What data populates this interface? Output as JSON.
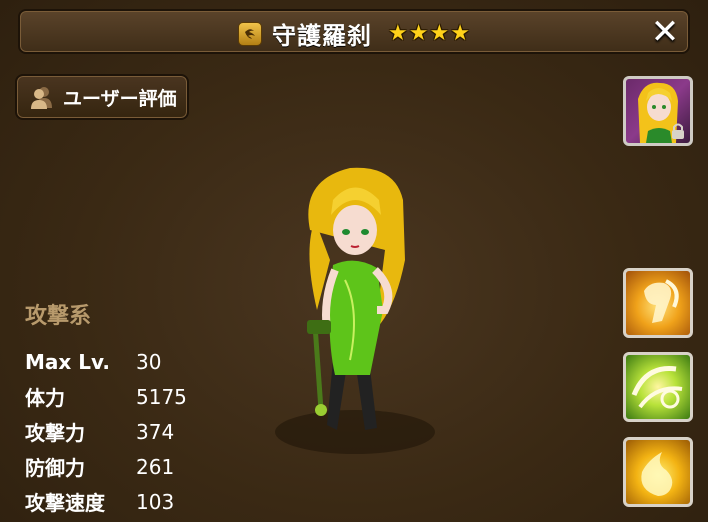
{
  "header": {
    "element_icon": "wind-element-icon",
    "title": "守護羅刹",
    "stars": [
      "★",
      "★",
      "★",
      "★"
    ],
    "close_icon": "✕"
  },
  "rating_button": {
    "icon": "users-icon",
    "label": "ユーザー評価"
  },
  "portrait": {
    "icon": "monster-portrait",
    "lock_icon": "lock-icon"
  },
  "skills": [
    {
      "icon": "skill-punch-icon"
    },
    {
      "icon": "skill-wind-icon"
    },
    {
      "icon": "skill-flame-icon"
    }
  ],
  "stats": {
    "type": "攻撃系",
    "rows": [
      {
        "name": "Max Lv.",
        "value": "30"
      },
      {
        "name": "体力",
        "value": "5175"
      },
      {
        "name": "攻撃力",
        "value": "374"
      },
      {
        "name": "防御力",
        "value": "261"
      },
      {
        "name": "攻撃速度",
        "value": "103"
      }
    ]
  }
}
